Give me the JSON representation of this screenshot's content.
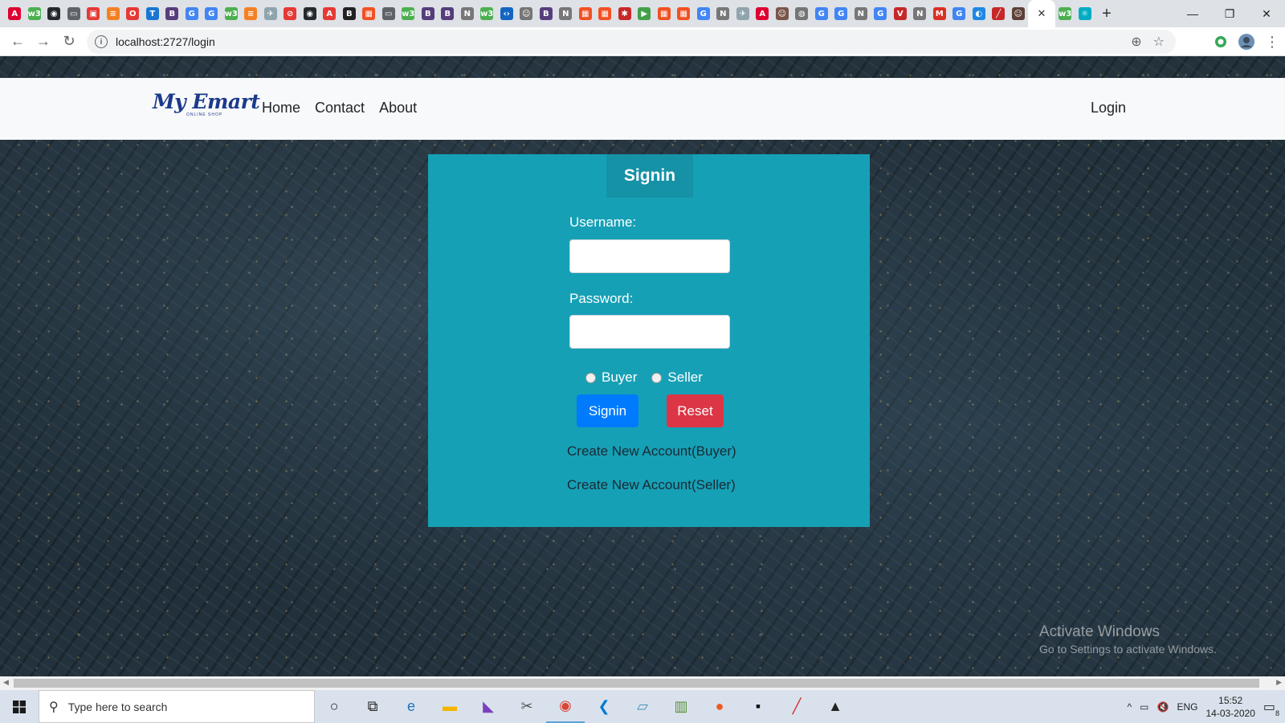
{
  "browser": {
    "url": "localhost:2727/login",
    "tabs_favicons": [
      {
        "icon": "angular-icon",
        "color": "#dd0031",
        "glyph": "A"
      },
      {
        "icon": "w3schools-icon",
        "color": "#4caf50",
        "glyph": "w3"
      },
      {
        "icon": "github-icon",
        "color": "#24292e",
        "glyph": "◉"
      },
      {
        "icon": "chat-icon",
        "color": "#5f6368",
        "glyph": "▭"
      },
      {
        "icon": "app-icon",
        "color": "#e53935",
        "glyph": "▣"
      },
      {
        "icon": "stackoverflow-icon",
        "color": "#f48024",
        "glyph": "≡"
      },
      {
        "icon": "opera-icon",
        "color": "#e53935",
        "glyph": "O"
      },
      {
        "icon": "typescript-icon",
        "color": "#1976d2",
        "glyph": "T"
      },
      {
        "icon": "bootstrap-icon",
        "color": "#563d7c",
        "glyph": "B"
      },
      {
        "icon": "google-icon",
        "color": "#4285f4",
        "glyph": "G"
      },
      {
        "icon": "google-icon",
        "color": "#4285f4",
        "glyph": "G"
      },
      {
        "icon": "w3schools-icon",
        "color": "#4caf50",
        "glyph": "w3"
      },
      {
        "icon": "stackoverflow-icon",
        "color": "#f48024",
        "glyph": "≡"
      },
      {
        "icon": "plane-icon",
        "color": "#90a4ae",
        "glyph": "✈"
      },
      {
        "icon": "blocked-icon",
        "color": "#e53935",
        "glyph": "⊘"
      },
      {
        "icon": "github-icon",
        "color": "#24292e",
        "glyph": "◉"
      },
      {
        "icon": "acrobat-icon",
        "color": "#e53935",
        "glyph": "A"
      },
      {
        "icon": "bold-icon",
        "color": "#222222",
        "glyph": "B"
      },
      {
        "icon": "microsoft-icon",
        "color": "#f25022",
        "glyph": "▦"
      },
      {
        "icon": "chat-icon",
        "color": "#5f6368",
        "glyph": "▭"
      },
      {
        "icon": "w3schools-icon",
        "color": "#4caf50",
        "glyph": "w3"
      },
      {
        "icon": "bootstrap-icon",
        "color": "#563d7c",
        "glyph": "B"
      },
      {
        "icon": "bootstrap-icon",
        "color": "#563d7c",
        "glyph": "B"
      },
      {
        "icon": "notion-icon",
        "color": "#777777",
        "glyph": "N"
      },
      {
        "icon": "w3schools-icon",
        "color": "#4caf50",
        "glyph": "w3"
      },
      {
        "icon": "code-icon",
        "color": "#1565c0",
        "glyph": "‹›"
      },
      {
        "icon": "person-icon",
        "color": "#757575",
        "glyph": "☺"
      },
      {
        "icon": "bootstrap-icon",
        "color": "#563d7c",
        "glyph": "B"
      },
      {
        "icon": "notion-icon",
        "color": "#777777",
        "glyph": "N"
      },
      {
        "icon": "microsoft-icon",
        "color": "#f25022",
        "glyph": "▦"
      },
      {
        "icon": "microsoft-icon",
        "color": "#f25022",
        "glyph": "▦"
      },
      {
        "icon": "bug-icon",
        "color": "#c62828",
        "glyph": "✱"
      },
      {
        "icon": "play-icon",
        "color": "#43a047",
        "glyph": "▶"
      },
      {
        "icon": "microsoft-icon",
        "color": "#f25022",
        "glyph": "▦"
      },
      {
        "icon": "microsoft-icon",
        "color": "#f25022",
        "glyph": "▦"
      },
      {
        "icon": "google-icon",
        "color": "#4285f4",
        "glyph": "G"
      },
      {
        "icon": "notion-icon",
        "color": "#777777",
        "glyph": "N"
      },
      {
        "icon": "plane-icon",
        "color": "#90a4ae",
        "glyph": "✈"
      },
      {
        "icon": "angular-icon",
        "color": "#dd0031",
        "glyph": "A"
      },
      {
        "icon": "person-icon",
        "color": "#795548",
        "glyph": "☺"
      },
      {
        "icon": "globe-icon",
        "color": "#757575",
        "glyph": "◍"
      },
      {
        "icon": "google-icon",
        "color": "#4285f4",
        "glyph": "G"
      },
      {
        "icon": "google-icon",
        "color": "#4285f4",
        "glyph": "G"
      },
      {
        "icon": "notion-icon",
        "color": "#777777",
        "glyph": "N"
      },
      {
        "icon": "google-icon",
        "color": "#4285f4",
        "glyph": "G"
      },
      {
        "icon": "vivaldi-icon",
        "color": "#c62828",
        "glyph": "V"
      },
      {
        "icon": "notion-icon",
        "color": "#777777",
        "glyph": "N"
      },
      {
        "icon": "gmail-icon",
        "color": "#d93025",
        "glyph": "M"
      },
      {
        "icon": "google-icon",
        "color": "#4285f4",
        "glyph": "G"
      },
      {
        "icon": "browser-icon",
        "color": "#1e88e5",
        "glyph": "◐"
      },
      {
        "icon": "pen-icon",
        "color": "#c62828",
        "glyph": "╱"
      },
      {
        "icon": "person-icon",
        "color": "#5d4037",
        "glyph": "☺"
      }
    ],
    "active_tab_close": "✕",
    "after_tabs": [
      {
        "icon": "w3schools-icon",
        "color": "#4caf50",
        "glyph": "w3"
      },
      {
        "icon": "react-icon",
        "color": "#00acc1",
        "glyph": "⚛"
      }
    ],
    "new_tab": "+",
    "window": {
      "minimize": "—",
      "maximize": "❐",
      "close": "✕"
    },
    "nav": {
      "back": "←",
      "forward": "→",
      "reload": "↻"
    },
    "info_icon": "i",
    "omni_icons": {
      "zoom": "⊕",
      "star": "☆"
    },
    "extension_color": "#34a853",
    "menu": "⋮"
  },
  "site": {
    "brand": "My Emart",
    "brand_tagline": "ONLINE SHOP",
    "nav_links": [
      "Home",
      "Contact",
      "About"
    ],
    "login": "Login"
  },
  "signin": {
    "title": "Signin",
    "username_label": "Username:",
    "password_label": "Password:",
    "username_value": "",
    "password_value": "",
    "role_buyer": "Buyer",
    "role_seller": "Seller",
    "signin_button": "Signin",
    "reset_button": "Reset",
    "create_buyer": "Create New Account(Buyer)",
    "create_seller": "Create New Account(Seller)"
  },
  "watermark": {
    "line1": "Activate Windows",
    "line2": "Go to Settings to activate Windows."
  },
  "taskbar": {
    "search_placeholder": "Type here to search",
    "apps": [
      {
        "name": "cortana-icon",
        "glyph": "○",
        "color": "#222222"
      },
      {
        "name": "task-view-icon",
        "glyph": "⧉",
        "color": "#222222"
      },
      {
        "name": "edge-icon",
        "glyph": "e",
        "color": "#1e73be"
      },
      {
        "name": "file-explorer-icon",
        "glyph": "▬",
        "color": "#f4b400"
      },
      {
        "name": "visual-studio-icon",
        "glyph": "◣",
        "color": "#7b3fbf"
      },
      {
        "name": "tools-icon",
        "glyph": "✂",
        "color": "#555555"
      },
      {
        "name": "chrome-icon",
        "glyph": "◉",
        "color": "#db4437"
      },
      {
        "name": "vscode-icon",
        "glyph": "❮",
        "color": "#0078d4"
      },
      {
        "name": "notepad-icon",
        "glyph": "▱",
        "color": "#4a90b8"
      },
      {
        "name": "sql-server-icon",
        "glyph": "▥",
        "color": "#5a8f3a"
      },
      {
        "name": "postman-icon",
        "glyph": "●",
        "color": "#ef5b25"
      },
      {
        "name": "terminal-icon",
        "glyph": "▪",
        "color": "#111111"
      },
      {
        "name": "paint-icon",
        "glyph": "╱",
        "color": "#d32f2f"
      },
      {
        "name": "photos-icon",
        "glyph": "▲",
        "color": "#222222"
      }
    ],
    "tray": {
      "chevron": "^",
      "lang": "ENG",
      "time": "15:52",
      "date": "14-03-2020",
      "notifications": "8"
    }
  }
}
